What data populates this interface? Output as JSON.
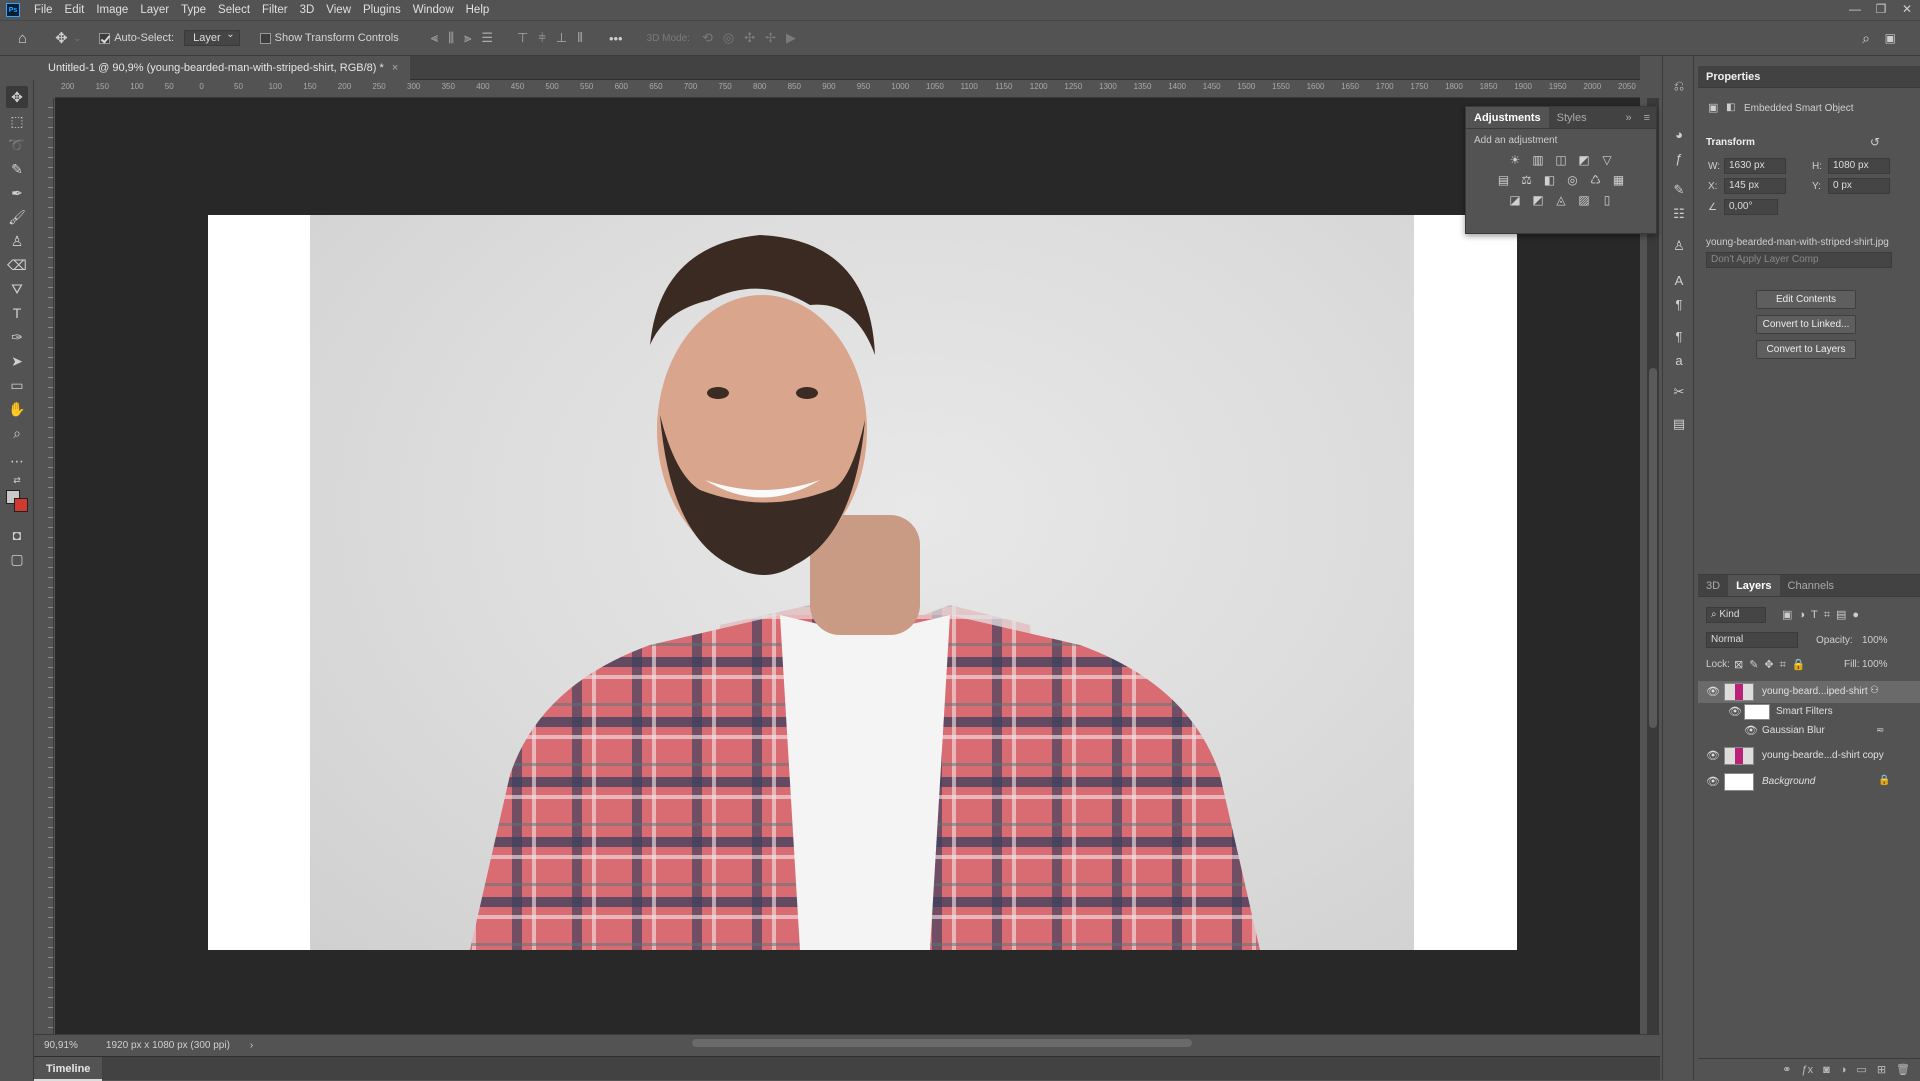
{
  "app": {
    "logo": "Ps"
  },
  "menu": [
    "File",
    "Edit",
    "Image",
    "Layer",
    "Type",
    "Select",
    "Filter",
    "3D",
    "View",
    "Plugins",
    "Window",
    "Help"
  ],
  "window_controls": {
    "minimize": "—",
    "restore": "❐",
    "close": "✕"
  },
  "options_bar": {
    "auto_select_label": "Auto-Select:",
    "auto_select_target": "Layer",
    "show_transform_label": "Show Transform Controls",
    "more": "•••",
    "mode_3d_label": "3D Mode:"
  },
  "document_tab": {
    "title": "Untitled-1 @ 90,9% (young-bearded-man-with-striped-shirt, RGB/8) *",
    "close": "×"
  },
  "ruler_ticks": [
    "200",
    "150",
    "100",
    "50",
    "0",
    "50",
    "100",
    "150",
    "200",
    "250",
    "300",
    "350",
    "400",
    "450",
    "500",
    "550",
    "600",
    "650",
    "700",
    "750",
    "800",
    "850",
    "900",
    "950",
    "1000",
    "1050",
    "1100",
    "1150",
    "1200",
    "1250",
    "1300",
    "1350",
    "1400",
    "1450",
    "1500",
    "1550",
    "1600",
    "1650",
    "1700",
    "1750",
    "1800",
    "1850",
    "1900",
    "1950",
    "2000",
    "2050"
  ],
  "status": {
    "zoom": "90,91%",
    "doc_info": "1920 px x 1080 px (300 ppi)",
    "arrow": "›"
  },
  "timeline": {
    "label": "Timeline"
  },
  "adjustments": {
    "tab_active": "Adjustments",
    "tab_other": "Styles",
    "hint": "Add an adjustment",
    "row1": [
      "☀",
      "▥",
      "◫",
      "◩",
      "▽"
    ],
    "row2": [
      "▤",
      "⚖",
      "◧",
      "◎",
      "♺",
      "▦"
    ],
    "row3": [
      "◪",
      "◩",
      "◬",
      "▨",
      "▯"
    ]
  },
  "properties": {
    "title": "Properties",
    "type": "Embedded Smart Object",
    "transform_label": "Transform",
    "w_label": "W:",
    "w_value": "1630 px",
    "h_label": "H:",
    "h_value": "1080 px",
    "x_label": "X:",
    "x_value": "145 px",
    "y_label": "Y:",
    "y_value": "0 px",
    "angle_value": "0,00°",
    "filename": "young-bearded-man-with-striped-shirt.jpg",
    "layer_comp_placeholder": "Don't Apply Layer Comp",
    "buttons": [
      "Edit Contents",
      "Convert to Linked...",
      "Convert to Layers"
    ]
  },
  "layers_panel": {
    "tabs": [
      "3D",
      "Layers",
      "Channels"
    ],
    "active_tab": "Layers",
    "filter_label": "Kind",
    "blend_mode": "Normal",
    "opacity_label": "Opacity:",
    "opacity_value": "100%",
    "lock_label": "Lock:",
    "fill_label": "Fill:",
    "fill_value": "100%",
    "layers": [
      {
        "name": "young-beard...iped-shirt"
      },
      {
        "name": "Smart Filters"
      },
      {
        "name": "Gaussian Blur"
      },
      {
        "name": "young-bearde...d-shirt copy"
      },
      {
        "name": "Background"
      }
    ]
  },
  "colors": {
    "foreground": "#c9c9c9",
    "background": "#d03a2f",
    "accent": "#31a8ff"
  }
}
